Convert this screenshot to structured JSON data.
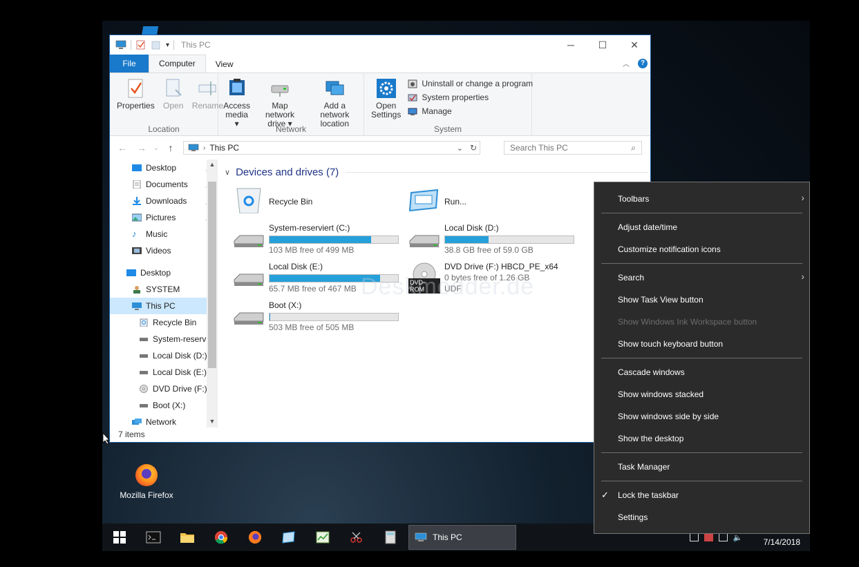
{
  "window": {
    "title": "This PC",
    "controls": {
      "minimize": "─",
      "maximize": "☐",
      "close": "✕"
    }
  },
  "ribbon": {
    "tabs": [
      "File",
      "Computer",
      "View"
    ],
    "groups": {
      "location": {
        "label": "Location",
        "buttons": [
          "Properties",
          "Open",
          "Rename"
        ]
      },
      "network": {
        "label": "Network",
        "access_media": [
          "Access",
          "media ▾"
        ],
        "map_drive": [
          "Map network",
          "drive ▾"
        ],
        "add_location": [
          "Add a network",
          "location"
        ]
      },
      "system": {
        "label": "System",
        "open_settings": [
          "Open",
          "Settings"
        ],
        "uninstall": "Uninstall or change a program",
        "system_properties": "System properties",
        "manage": "Manage"
      }
    }
  },
  "address": {
    "path": "This PC",
    "search_placeholder": "Search This PC"
  },
  "navpane": {
    "items": [
      {
        "label": "Desktop",
        "pinned": true
      },
      {
        "label": "Documents",
        "pinned": true
      },
      {
        "label": "Downloads",
        "pinned": true
      },
      {
        "label": "Pictures",
        "pinned": true
      },
      {
        "label": "Music"
      },
      {
        "label": "Videos"
      },
      {
        "label": "Desktop"
      },
      {
        "label": "SYSTEM"
      },
      {
        "label": "This PC"
      },
      {
        "label": "Recycle Bin"
      },
      {
        "label": "System-reservi"
      },
      {
        "label": "Local Disk (D:)"
      },
      {
        "label": "Local Disk (E:)"
      },
      {
        "label": "DVD Drive (F:) H"
      },
      {
        "label": "Boot (X:)"
      },
      {
        "label": "Network"
      }
    ]
  },
  "content": {
    "section_title": "Devices and drives (7)",
    "recycle_bin": "Recycle Bin",
    "run": "Run...",
    "drives": [
      {
        "name": "System-reserviert (C:)",
        "free": "103 MB free of 499 MB",
        "used_fraction": 0.79
      },
      {
        "name": "Local Disk (D:)",
        "free": "38.8 GB free of 59.0 GB",
        "used_fraction": 0.34
      },
      {
        "name": "Local Disk (E:)",
        "free": "65.7 MB free of 467 MB",
        "used_fraction": 0.86
      },
      {
        "name": "DVD Drive (F:) HBCD_PE_x64",
        "free": "0 bytes free of 1.26 GB",
        "fs": "UDF",
        "badge": "DVD-ROM"
      },
      {
        "name": "Boot (X:)",
        "free": "503 MB free of 505 MB",
        "used_fraction": 0.004
      }
    ]
  },
  "status": {
    "items": "7 items"
  },
  "watermark": "Deskmodder.de",
  "desktop_icon": {
    "label": "Mozilla Firefox"
  },
  "taskbar": {
    "active_label": "This PC",
    "clock": "7/14/2018"
  },
  "context_menu": {
    "toolbars": "Toolbars",
    "adjust_date": "Adjust date/time",
    "customize_icons": "Customize notification icons",
    "search": "Search",
    "task_view": "Show Task View button",
    "ink_workspace": "Show Windows Ink Workspace button",
    "touch_keyboard": "Show touch keyboard button",
    "cascade": "Cascade windows",
    "stacked": "Show windows stacked",
    "side_by_side": "Show windows side by side",
    "show_desktop": "Show the desktop",
    "task_manager": "Task Manager",
    "lock_taskbar": "Lock the taskbar",
    "settings": "Settings"
  },
  "colors": {
    "accent": "#1979ca",
    "drive_bar": "#26a0da",
    "menu_bg": "#2b2b2b"
  }
}
